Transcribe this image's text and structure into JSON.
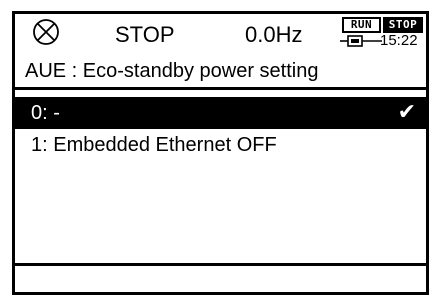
{
  "status": {
    "alarm_icon": "circled-x-icon",
    "state": "STOP",
    "frequency": "0.0Hz",
    "run_label": "RUN",
    "stop_label": "STOP",
    "connection_icon": "connector-icon",
    "time": "15:22"
  },
  "parameter": {
    "title": "AUE : Eco-standby power setting"
  },
  "options": [
    {
      "label": "0: -",
      "selected": true,
      "check_icon": "checkmark-icon"
    },
    {
      "label": "1: Embedded Ethernet OFF",
      "selected": false
    }
  ],
  "colors": {
    "foreground": "#000000",
    "background": "#ffffff"
  }
}
